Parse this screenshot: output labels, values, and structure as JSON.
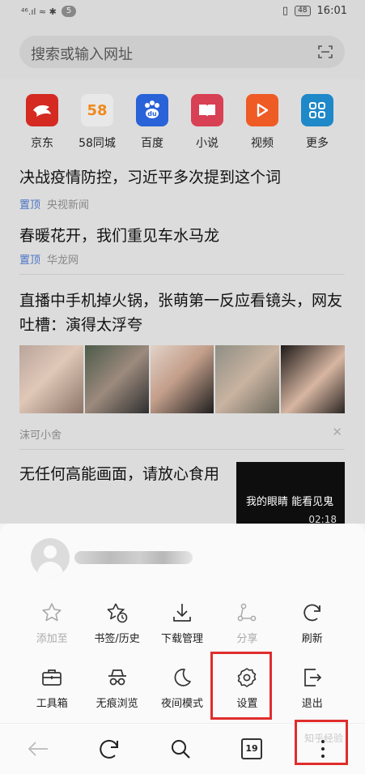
{
  "status_bar": {
    "network": "⁴⁶.ıl ≈ ✱",
    "badge": "5",
    "battery": "48",
    "time": "16:01"
  },
  "search": {
    "placeholder": "搜索或输入网址"
  },
  "shortcuts": [
    {
      "label": "京东",
      "icon": "jd-icon",
      "color": "#d42a22",
      "glyph": ""
    },
    {
      "label": "58同城",
      "icon": "58-icon",
      "color": "#e8e8e8",
      "glyph": "58"
    },
    {
      "label": "百度",
      "icon": "baidu-icon",
      "color": "#2a62d8",
      "glyph": "du"
    },
    {
      "label": "小说",
      "icon": "novel-icon",
      "color": "#d84054",
      "glyph": ""
    },
    {
      "label": "视频",
      "icon": "video-icon",
      "color": "#ef5b24",
      "glyph": "▶"
    },
    {
      "label": "更多",
      "icon": "more-grid-icon",
      "color": "#1e88c9",
      "glyph": ""
    }
  ],
  "news": [
    {
      "title": "决战疫情防控，习近平多次提到这个词",
      "tag": "置顶",
      "source": "央视新闻"
    },
    {
      "title": "春暖花开，我们重见车水马龙",
      "tag": "置顶",
      "source": "华龙网"
    },
    {
      "title": "直播中手机掉火锅，张萌第一反应看镜头，网友吐槽：演得太浮夸",
      "source": "沫可小舍"
    },
    {
      "title": "无任何高能画面，请放心食用",
      "thumb_caption": "我的眼睛 能看见鬼",
      "duration": "02:18"
    }
  ],
  "menu": {
    "row1": [
      {
        "label": "添加至",
        "icon": "star-outline-icon",
        "enabled": false
      },
      {
        "label": "书签/历史",
        "icon": "bookmark-history-icon",
        "enabled": true
      },
      {
        "label": "下载管理",
        "icon": "download-icon",
        "enabled": true
      },
      {
        "label": "分享",
        "icon": "share-icon",
        "enabled": false
      },
      {
        "label": "刷新",
        "icon": "refresh-icon",
        "enabled": true
      }
    ],
    "row2": [
      {
        "label": "工具箱",
        "icon": "toolbox-icon",
        "enabled": true
      },
      {
        "label": "无痕浏览",
        "icon": "incognito-icon",
        "enabled": true
      },
      {
        "label": "夜间模式",
        "icon": "moon-icon",
        "enabled": true
      },
      {
        "label": "设置",
        "icon": "gear-icon",
        "enabled": true
      },
      {
        "label": "退出",
        "icon": "exit-icon",
        "enabled": true
      }
    ]
  },
  "navbar": {
    "tab_count": "19"
  },
  "watermark": "知乎经验",
  "colors": {
    "highlight": "#e02d2d",
    "tag": "#4b74c4"
  }
}
